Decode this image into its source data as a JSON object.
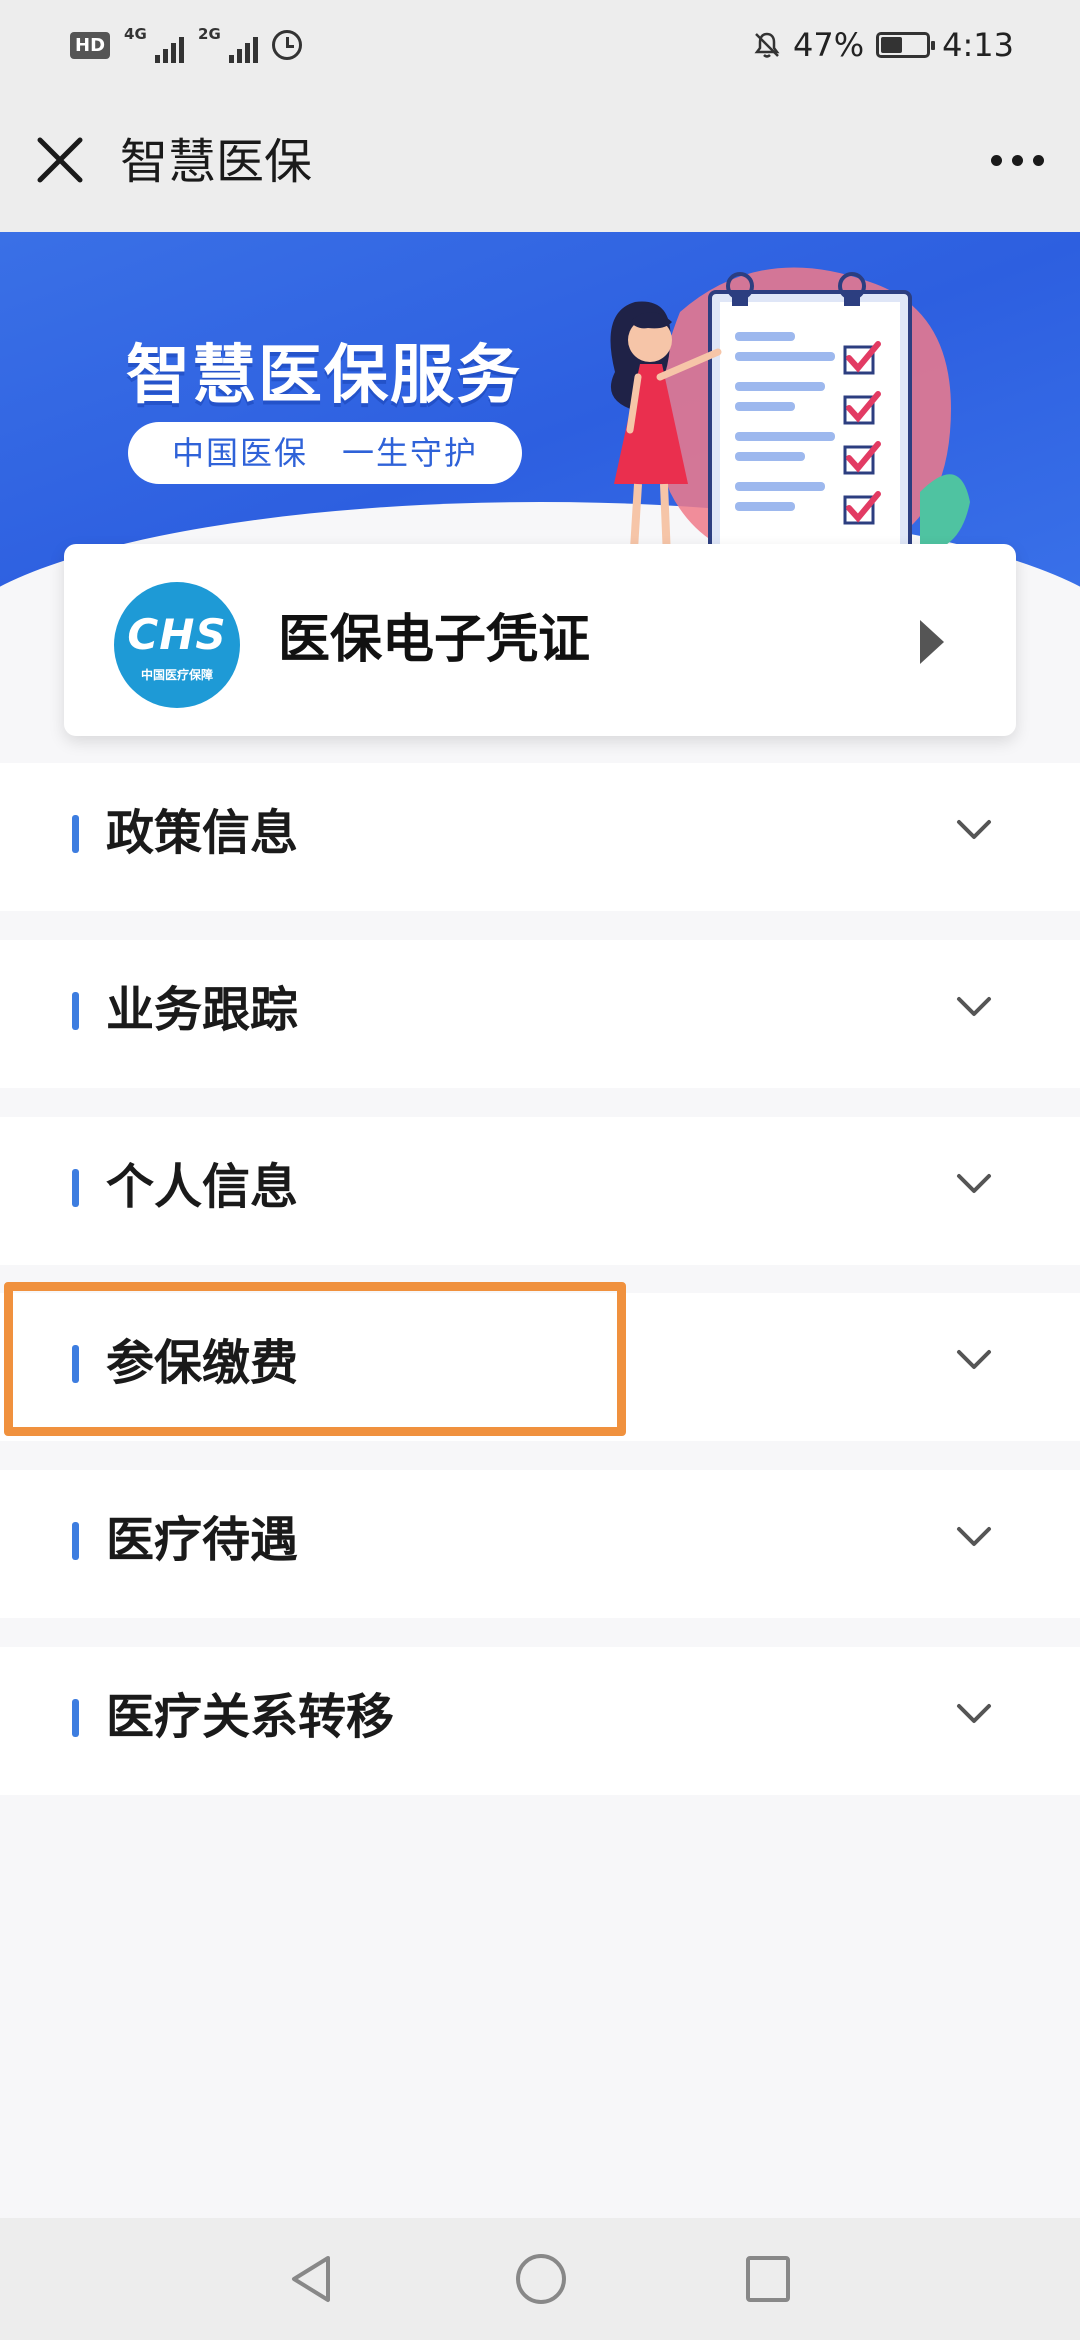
{
  "status_bar": {
    "hd_label": "HD",
    "sim1_network": "4G",
    "sim2_network": "2G",
    "battery_percent": "47%",
    "battery_level": 0.47,
    "time": "4:13"
  },
  "header": {
    "title": "智慧医保",
    "close_icon": "close-icon",
    "more_icon": "more-dots-icon"
  },
  "banner": {
    "heading": "智慧医保服务",
    "slogan": "中国医保　一生守护"
  },
  "credential_card": {
    "logo_text": "CHS",
    "logo_subtext": "中国医疗保障",
    "title": "医保电子凭证",
    "arrow_icon": "play-arrow-icon"
  },
  "menu": {
    "items": [
      {
        "label": "政策信息"
      },
      {
        "label": "业务跟踪"
      },
      {
        "label": "个人信息"
      },
      {
        "label": "参保缴费"
      },
      {
        "label": "医疗待遇"
      },
      {
        "label": "医疗关系转移"
      }
    ],
    "highlighted_item": "参保缴费",
    "highlight_color": "#f0913e",
    "accent_color": "#3d7de0"
  },
  "nav_bar": {
    "icons": [
      "back-icon",
      "home-icon",
      "recent-apps-icon"
    ]
  }
}
